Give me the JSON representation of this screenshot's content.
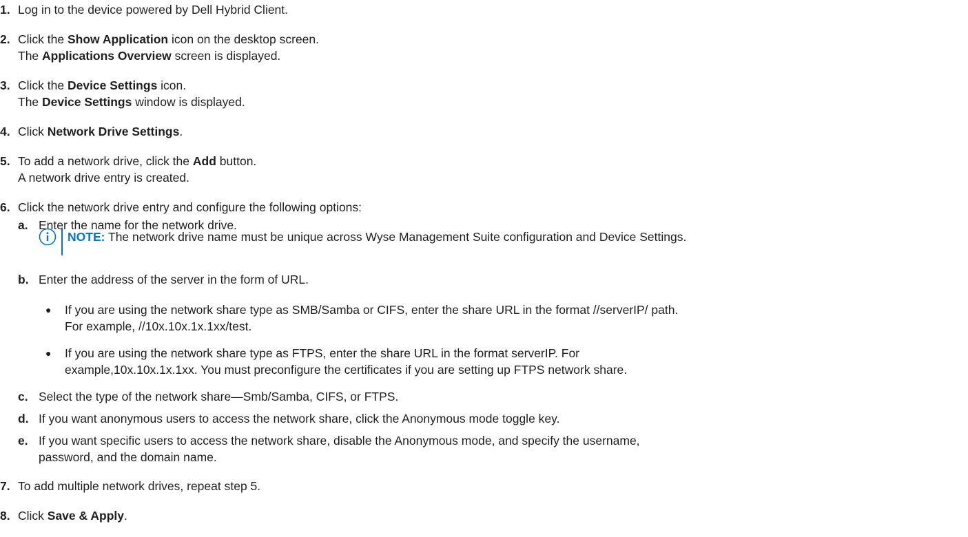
{
  "steps": [
    {
      "num": "1.",
      "parts": [
        "Log in to the device powered by Dell Hybrid Client."
      ]
    },
    {
      "num": "2.",
      "pre": "Click the ",
      "bold": "Show Application",
      "post": " icon on the desktop screen.",
      "line2_pre": "The ",
      "line2_bold": "Applications Overview",
      "line2_post": " screen is displayed."
    },
    {
      "num": "3.",
      "pre": "Click the ",
      "bold": "Device Settings",
      "post": " icon.",
      "line2_pre": "The ",
      "line2_bold": "Device Settings",
      "line2_post": " window is displayed."
    },
    {
      "num": "4.",
      "pre": "Click ",
      "bold": "Network Drive Settings",
      "post": "."
    },
    {
      "num": "5.",
      "pre": "To add a network drive, click the ",
      "bold": "Add",
      "post": " button.",
      "line2": "A network drive entry is created."
    },
    {
      "num": "6.",
      "text": "Click the network drive entry and configure the following options:"
    },
    {
      "num": "7.",
      "text": "To add multiple network drives, repeat step 5."
    },
    {
      "num": "8.",
      "pre": "Click ",
      "bold": "Save & Apply",
      "post": "."
    }
  ],
  "step1_text": "Log in to the device powered by Dell Hybrid Client.",
  "substeps": [
    {
      "letter": "a.",
      "text": "Enter the name for the network drive."
    },
    {
      "letter": "b.",
      "text": "Enter the address of the server in the form of URL."
    },
    {
      "letter": "c.",
      "text": "Select the type of the network share—Smb/Samba, CIFS, or FTPS."
    },
    {
      "letter": "d.",
      "text": "If you want anonymous users to access the network share, click the Anonymous mode toggle key."
    },
    {
      "letter": "e.",
      "line1": "If you want specific users to access the network share, disable the Anonymous mode, and specify the username,",
      "line2": "password, and the domain name."
    }
  ],
  "note": {
    "label": "NOTE:",
    "text": " The network drive name must be unique across Wyse Management Suite configuration and Device Settings.",
    "icon": "info-icon",
    "accent": "#0076ce"
  },
  "bullets": [
    {
      "line1": "If you are using the network share type as SMB/Samba or CIFS, enter the share URL in the format //serverIP/ path.",
      "line2": "For example, //10x.10x.1x.1xx/test."
    },
    {
      "line1": "If you are using the network share type as FTPS, enter the share URL in the format serverIP. For",
      "line2": "example,10x.10x.1x.1xx. You must preconfigure the certificates if you are setting up FTPS network share."
    }
  ],
  "bullet_glyph": "●"
}
